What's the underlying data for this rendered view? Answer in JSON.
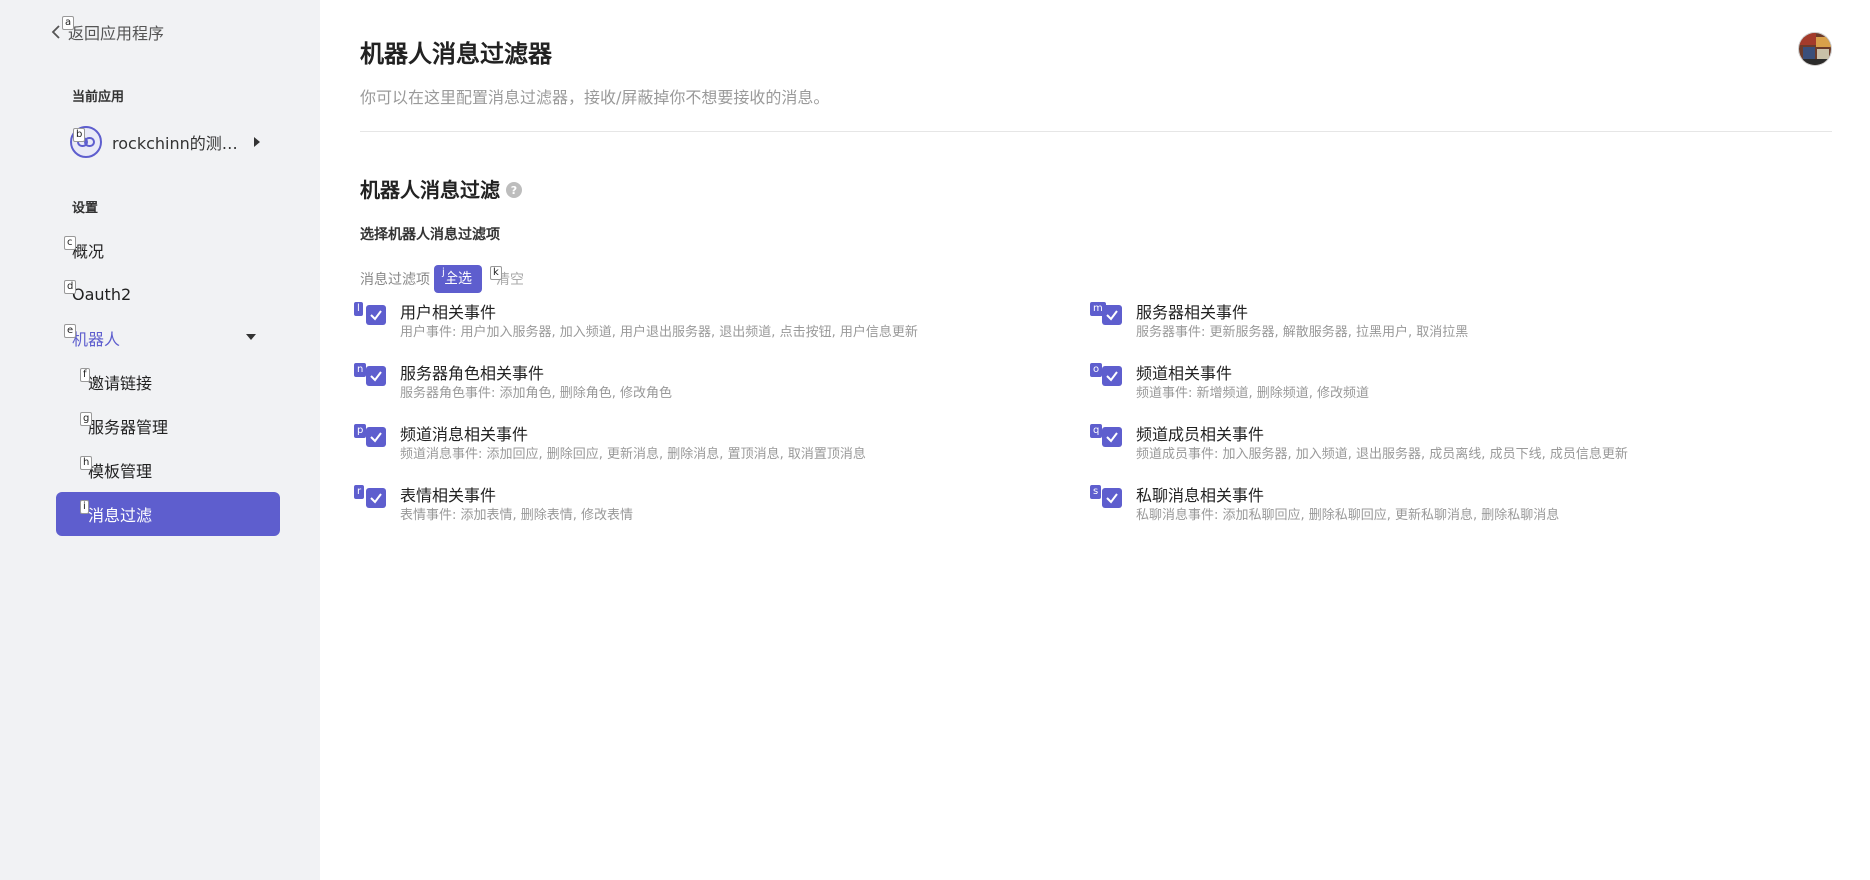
{
  "sidebar": {
    "back_label": "返回应用程序",
    "current_app_title": "当前应用",
    "app_name": "rockchinn的测试应用",
    "settings_title": "设置",
    "nav": {
      "overview": "概况",
      "oauth2": "Oauth2",
      "bot": "机器人",
      "invite": "邀请链接",
      "servers": "服务器管理",
      "templates": "模板管理",
      "filter": "消息过滤"
    }
  },
  "main": {
    "title": "机器人消息过滤器",
    "description": "你可以在这里配置消息过滤器，接收/屏蔽掉你不想要接收的消息。",
    "section_title": "机器人消息过滤",
    "subsection_title": "选择机器人消息过滤项",
    "filter_label": "消息过滤项",
    "select_all": "全选",
    "clear": "清空",
    "events": [
      {
        "title": "用户相关事件",
        "desc": "用户事件: 用户加入服务器, 加入频道, 用户退出服务器, 退出频道, 点击按钮, 用户信息更新",
        "checked": true
      },
      {
        "title": "服务器相关事件",
        "desc": "服务器事件: 更新服务器, 解散服务器, 拉黑用户, 取消拉黑",
        "checked": true
      },
      {
        "title": "服务器角色相关事件",
        "desc": "服务器角色事件: 添加角色, 删除角色, 修改角色",
        "checked": true
      },
      {
        "title": "频道相关事件",
        "desc": "频道事件: 新增频道, 删除频道, 修改频道",
        "checked": true
      },
      {
        "title": "频道消息相关事件",
        "desc": "频道消息事件: 添加回应, 删除回应, 更新消息, 删除消息, 置顶消息, 取消置顶消息",
        "checked": true
      },
      {
        "title": "频道成员相关事件",
        "desc": "频道成员事件: 加入服务器, 加入频道, 退出服务器, 成员离线, 成员下线, 成员信息更新",
        "checked": true
      },
      {
        "title": "表情相关事件",
        "desc": "表情事件: 添加表情, 删除表情, 修改表情",
        "checked": true
      },
      {
        "title": "私聊消息相关事件",
        "desc": "私聊消息事件: 添加私聊回应, 删除私聊回应, 更新私聊消息, 删除私聊消息",
        "checked": true
      }
    ]
  },
  "hints": {
    "a": "a",
    "b": "b",
    "c": "c",
    "d": "d",
    "e": "e",
    "f": "f",
    "g": "g",
    "h": "h",
    "i": "i",
    "j": "j",
    "k": "k",
    "l": "l",
    "m": "m",
    "n": "n",
    "o": "o",
    "p": "p",
    "q": "q",
    "r": "r",
    "s": "s"
  },
  "colors": {
    "accent": "#5e5ece",
    "sidebar_bg": "#f1f2f4"
  }
}
